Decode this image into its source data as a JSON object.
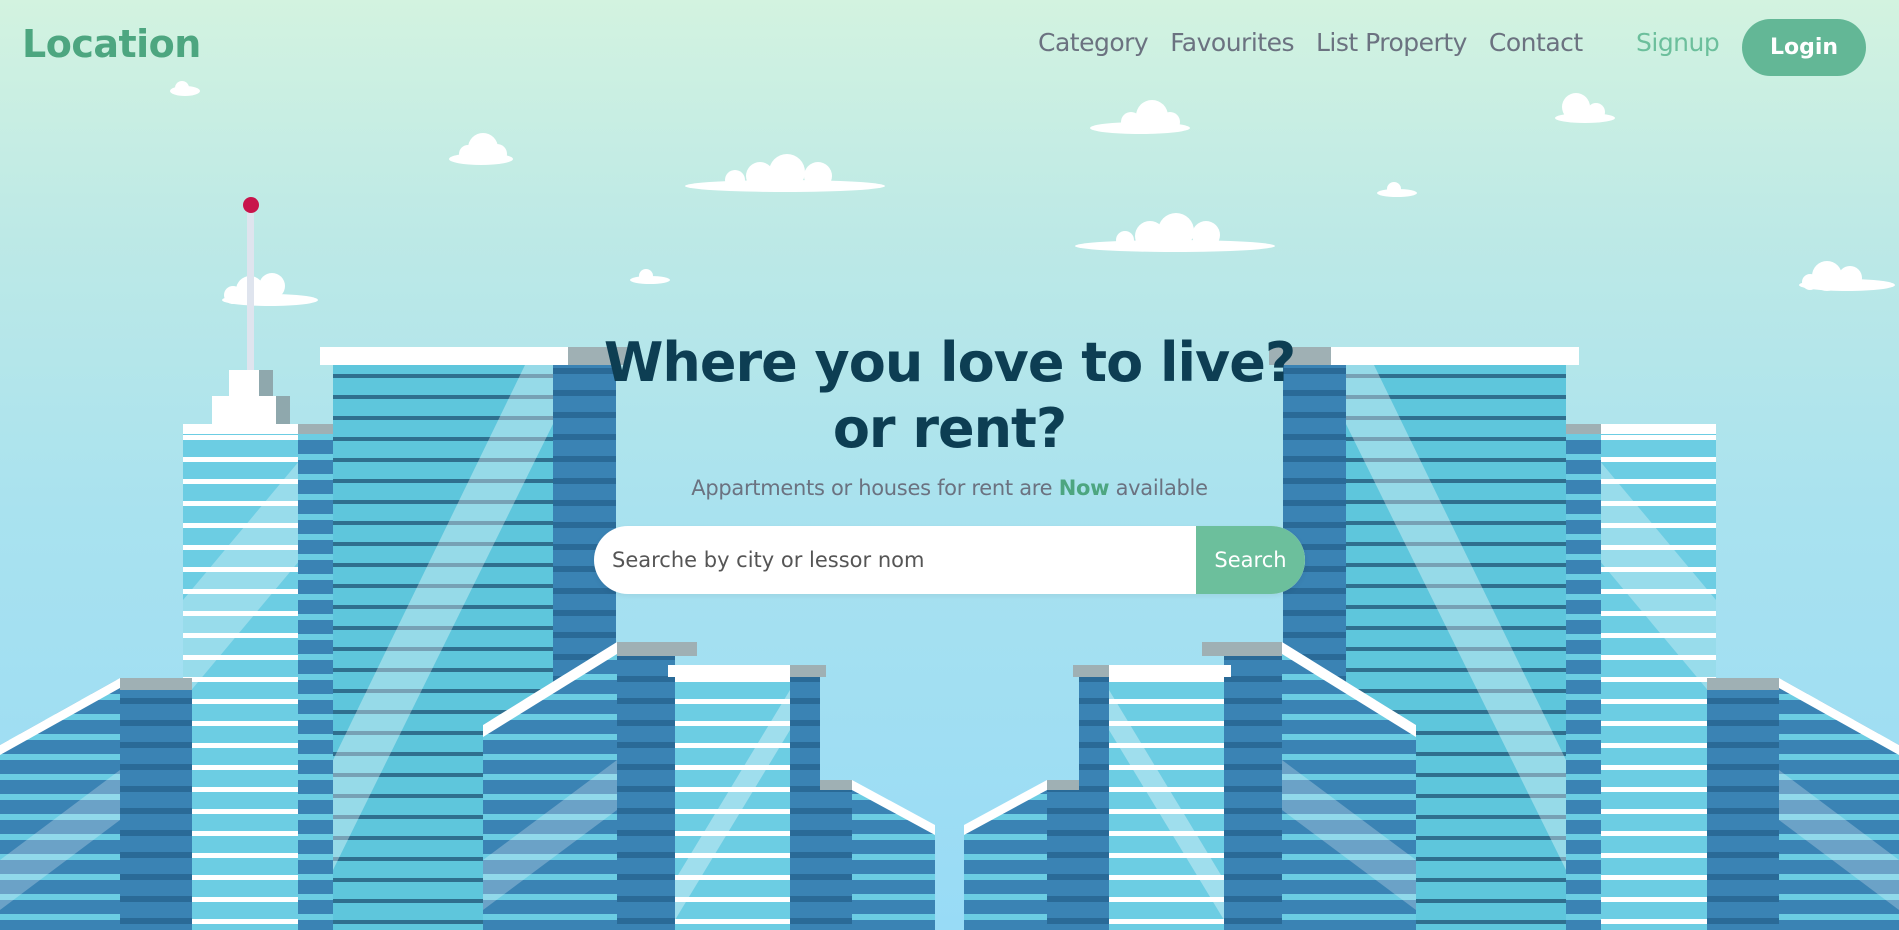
{
  "nav": {
    "logo": "Location",
    "links": [
      "Category",
      "Favourites",
      "List Property",
      "Contact"
    ],
    "signup": "Signup",
    "login": "Login"
  },
  "hero": {
    "title_line1": "Where you love to live?",
    "title_line2": "or rent?",
    "subtitle_before": "Appartments or houses for rent are",
    "subtitle_highlight": "Now",
    "subtitle_after": "available"
  },
  "search": {
    "placeholder": "Searche by city or lessor nom",
    "button": "Search"
  },
  "colors": {
    "brand": "#4da680",
    "accent": "#63b796",
    "heading": "#0d3e53"
  }
}
